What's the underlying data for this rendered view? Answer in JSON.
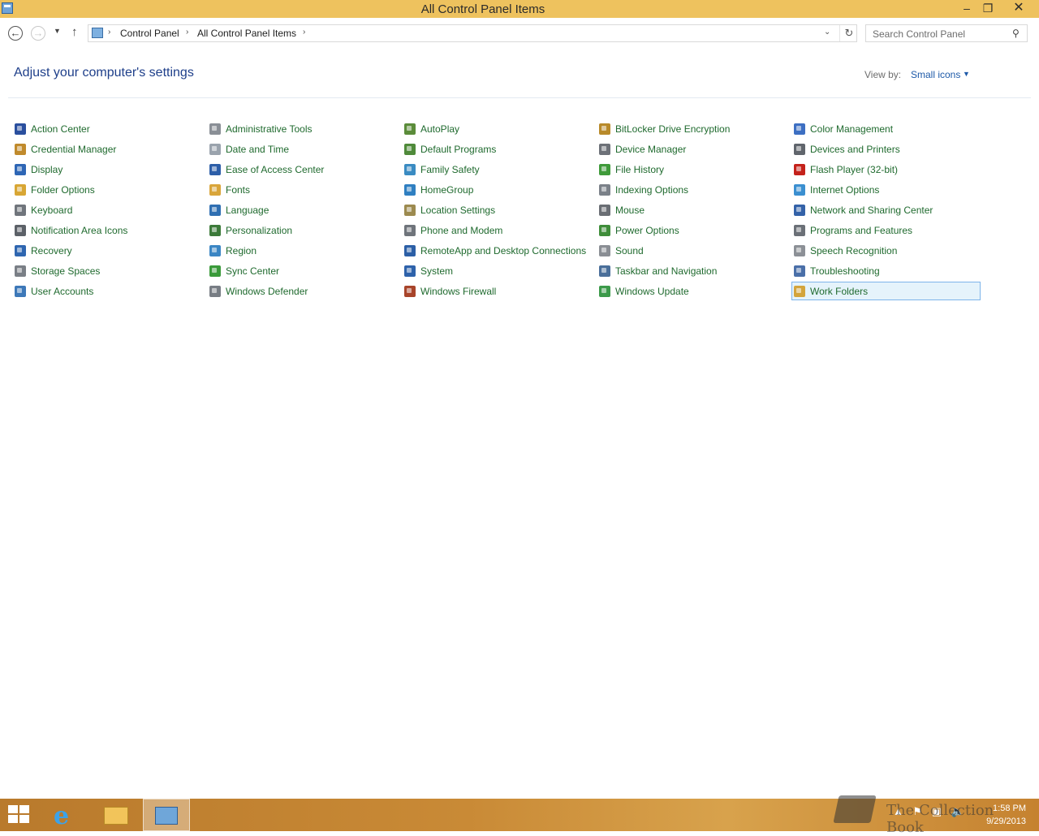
{
  "window": {
    "title": "All Control Panel Items",
    "minimize_glyph": "–",
    "maximize_glyph": "❐",
    "close_glyph": "✕"
  },
  "nav": {
    "back_glyph": "←",
    "forward_glyph": "→",
    "recent_glyph": "▼",
    "up_glyph": "↑",
    "breadcrumbs": [
      "Control Panel",
      "All Control Panel Items"
    ],
    "crumb_separator": "›",
    "dropdown_glyph": "⌄",
    "refresh_glyph": "↻"
  },
  "search": {
    "placeholder": "Search Control Panel",
    "icon": "search-icon",
    "icon_glyph": "⚲"
  },
  "main": {
    "title": "Adjust your computer's settings",
    "view_by_label": "View by:",
    "view_by_value": "Small icons",
    "view_by_caret": "▼"
  },
  "items": [
    {
      "label": "Action Center",
      "icon_color": "#2a4f9e"
    },
    {
      "label": "Administrative Tools",
      "icon_color": "#8a8f96"
    },
    {
      "label": "AutoPlay",
      "icon_color": "#5b8c3a"
    },
    {
      "label": "BitLocker Drive Encryption",
      "icon_color": "#b88a2a"
    },
    {
      "label": "Color Management",
      "icon_color": "#3d6fc2"
    },
    {
      "label": "Credential Manager",
      "icon_color": "#c08a2c"
    },
    {
      "label": "Date and Time",
      "icon_color": "#9aa3ad"
    },
    {
      "label": "Default Programs",
      "icon_color": "#4f8a3a"
    },
    {
      "label": "Device Manager",
      "icon_color": "#6d7178"
    },
    {
      "label": "Devices and Printers",
      "icon_color": "#60656c"
    },
    {
      "label": "Display",
      "icon_color": "#2e66b5"
    },
    {
      "label": "Ease of Access Center",
      "icon_color": "#2d5ea8"
    },
    {
      "label": "Family Safety",
      "icon_color": "#3a8bc2"
    },
    {
      "label": "File History",
      "icon_color": "#3f9a3a"
    },
    {
      "label": "Flash Player (32-bit)",
      "icon_color": "#c4221b"
    },
    {
      "label": "Folder Options",
      "icon_color": "#d8a634"
    },
    {
      "label": "Fonts",
      "icon_color": "#d9a53a"
    },
    {
      "label": "HomeGroup",
      "icon_color": "#2f7fc1"
    },
    {
      "label": "Indexing Options",
      "icon_color": "#7b8189"
    },
    {
      "label": "Internet Options",
      "icon_color": "#3b8fd0"
    },
    {
      "label": "Keyboard",
      "icon_color": "#70757c"
    },
    {
      "label": "Language",
      "icon_color": "#2f6fb2"
    },
    {
      "label": "Location Settings",
      "icon_color": "#9c8a4f"
    },
    {
      "label": "Mouse",
      "icon_color": "#6a6e74"
    },
    {
      "label": "Network and Sharing Center",
      "icon_color": "#3462a8"
    },
    {
      "label": "Notification Area Icons",
      "icon_color": "#5c6168"
    },
    {
      "label": "Personalization",
      "icon_color": "#3c7a3a"
    },
    {
      "label": "Phone and Modem",
      "icon_color": "#6f747b"
    },
    {
      "label": "Power Options",
      "icon_color": "#3f8d3a"
    },
    {
      "label": "Programs and Features",
      "icon_color": "#6b7077"
    },
    {
      "label": "Recovery",
      "icon_color": "#2f66b0"
    },
    {
      "label": "Region",
      "icon_color": "#3b86c4"
    },
    {
      "label": "RemoteApp and Desktop Connections",
      "icon_color": "#2c5fa6"
    },
    {
      "label": "Sound",
      "icon_color": "#8a8e94"
    },
    {
      "label": "Speech Recognition",
      "icon_color": "#8c9096"
    },
    {
      "label": "Storage Spaces",
      "icon_color": "#7a7f86"
    },
    {
      "label": "Sync Center",
      "icon_color": "#3a9a3a"
    },
    {
      "label": "System",
      "icon_color": "#2e62aa"
    },
    {
      "label": "Taskbar and Navigation",
      "icon_color": "#4a6f9a"
    },
    {
      "label": "Troubleshooting",
      "icon_color": "#4a6fa8"
    },
    {
      "label": "User Accounts",
      "icon_color": "#3d78b8"
    },
    {
      "label": "Windows Defender",
      "icon_color": "#787d84"
    },
    {
      "label": "Windows Firewall",
      "icon_color": "#a8442a"
    },
    {
      "label": "Windows Update",
      "icon_color": "#3c9a4a"
    },
    {
      "label": "Work Folders",
      "icon_color": "#d3a43c"
    }
  ],
  "selected_item": "Work Folders",
  "taskbar": {
    "ie_glyph": "e",
    "tray_glyphs": [
      "▲",
      "⚑",
      "▣",
      "🔈"
    ],
    "time": "1:58 PM",
    "date": "9/29/2013"
  },
  "watermark": {
    "text": "The Collection Book"
  }
}
